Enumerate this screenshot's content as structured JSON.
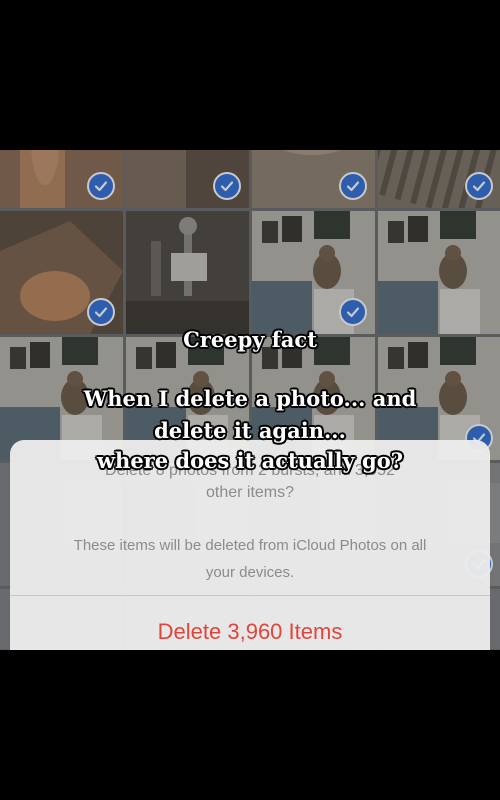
{
  "caption": {
    "title": "Creepy fact",
    "lines": [
      "When I delete a photo... and",
      "delete it again...",
      "where does it actually go?"
    ]
  },
  "sheet": {
    "message_line1": "Delete 8 photos from 2 bursts, and 3,952",
    "message_line2": "other items?",
    "sub_line1": "These items will be deleted from iCloud Photos on all",
    "sub_line2": "your devices.",
    "delete_label": "Delete 3,960 Items"
  },
  "colors": {
    "accent": "#2f6fd8",
    "destructive": "#e0453a"
  },
  "icons": {
    "checkmark": "checkmark-icon"
  }
}
